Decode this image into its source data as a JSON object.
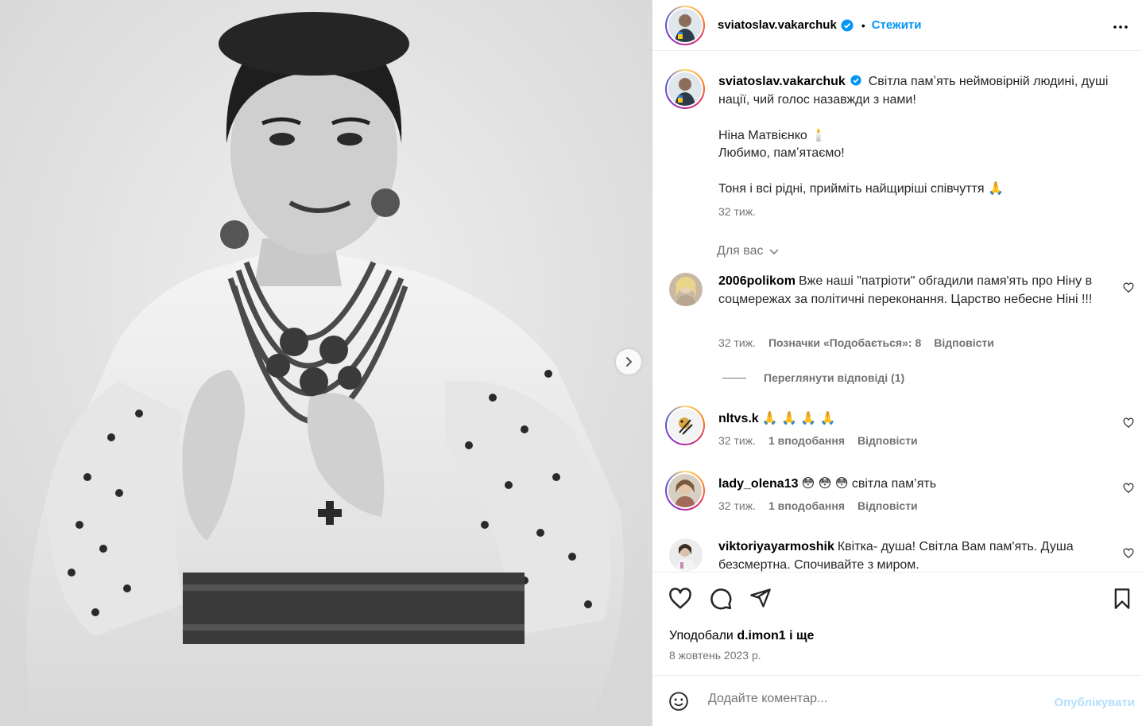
{
  "post": {
    "author": "sviatoslav.vakarchuk",
    "follow_label": "Стежити",
    "dot": "•"
  },
  "caption": {
    "username": "sviatoslav.vakarchuk",
    "text": "Світла памʼять неймовірній людині, душі нації, чий голос назавжди з нами!\n\nНіна Матвієнко 🕯️\nЛюбимо, памʼятаємо!\n\nТоня і всі рідні, прийміть найщиріші співчуття 🙏",
    "time": "32 тиж."
  },
  "for_you_label": "Для вас",
  "comments": [
    {
      "username": "2006polikom",
      "text": "Вже наші \"патріоти\" обгадили памя'ять про Ніну в соцмережах за політичні переконання. Царство небесне Ніні !!!",
      "time": "32 тиж.",
      "likes": "Позначки «Подобається»: 8",
      "reply": "Відповісти"
    },
    {
      "username": "nltvs.k",
      "text": "🙏 🙏 🙏 🙏",
      "time": "32 тиж.",
      "likes": "1 вподобання",
      "reply": "Відповісти"
    },
    {
      "username": "lady_olena13",
      "text": "😳 😳 😳 світла пам’ять",
      "time": "32 тиж.",
      "likes": "1 вподобання",
      "reply": "Відповісти"
    },
    {
      "username": "viktoriyayarmoshik",
      "text": "Квітка- душа! Світла Вам пам'ять. Душа безсмертна. Спочивайте з миром."
    }
  ],
  "view_replies": "Переглянути відповіді (1)",
  "likes_line": {
    "prefix": "Уподобали",
    "user": "d.imon1",
    "suffix": "і ще"
  },
  "date": "8 жовтень 2023 р.",
  "add_comment": {
    "placeholder": "Додайте коментар...",
    "publish": "Опублікувати"
  },
  "colors": {
    "accent": "#0095f6",
    "muted": "#737373",
    "publish_disabled": "#b2dffc"
  }
}
